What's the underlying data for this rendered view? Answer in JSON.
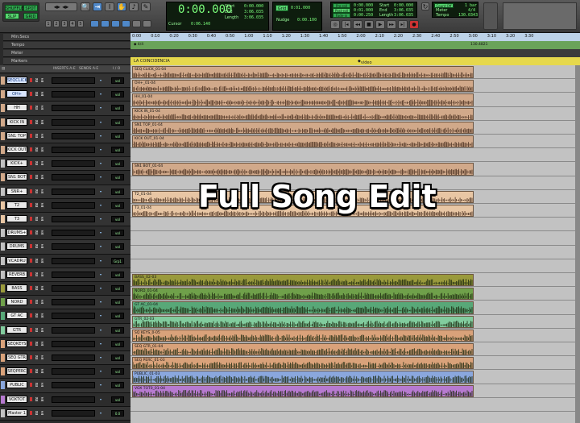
{
  "toolbar": {
    "mode_buttons": [
      "SHUFFLE",
      "SPOT",
      "SLIP",
      "GRID"
    ],
    "counter": "0:00.000",
    "cursor_label": "Cursor",
    "cursor_value": "0:06.140",
    "start_label": "Start",
    "end_label": "End",
    "length_label": "Length",
    "start_value": "0:00.000",
    "end_value": "3:06.035",
    "length_value": "3:06.035",
    "nudge_label": "Nudge",
    "nudge_value": "0:00.100",
    "grid_label": "Grid",
    "grid_value": "0:01.000",
    "preroll_label": "Pre-roll",
    "postroll_label": "Post-roll",
    "fadein_label": "Fade-in",
    "preroll_value": "0:00.000",
    "postroll_value": "0:01.000",
    "fadein_value": "0:00.250",
    "start2_value": "0:00.000",
    "end2_value": "3:06.035",
    "length2_value": "3:06.035",
    "countoff_label": "Count Off",
    "meter_label": "Meter",
    "tempo_label": "Tempo",
    "meter_value": "4/4",
    "tempo_value": "130.0343",
    "bars_value": "1 bar",
    "numbers": [
      "1",
      "2",
      "3",
      "4",
      "5"
    ]
  },
  "rulers": {
    "min_secs": "Min:Secs",
    "tempo": "Tempo",
    "meter": "Meter",
    "markers": "Markers",
    "ticks": [
      "0:00",
      "0:10",
      "0:20",
      "0:30",
      "0:40",
      "0:50",
      "1:00",
      "1:10",
      "1:20",
      "1:30",
      "1:40",
      "1:50",
      "2:00",
      "2:10",
      "2:20",
      "2:30",
      "2:40",
      "2:50",
      "3:00",
      "3:10",
      "3:20",
      "3:30"
    ],
    "tempo_value": "130.4821",
    "marker_1": "LA COINCIDENCIA",
    "marker_2": "video"
  },
  "column_headers": {
    "inserts": "INSERTS A-E",
    "sends": "SENDS A-E",
    "io": "I / O"
  },
  "tracks": [
    {
      "name": "SEQCLICK",
      "region": "SEQ CLICK_01-04",
      "color": "#d1a98a",
      "io": "vol",
      "small": false
    },
    {
      "name": "OH+",
      "region": "OH+_01-04",
      "color": "#d1a98a",
      "io": "vol",
      "small": true
    },
    {
      "name": "HH",
      "region": "HH_01-04",
      "color": "#d1a98a",
      "io": "vol",
      "small": true
    },
    {
      "name": "KICK IN",
      "region": "KICK IN_01-04",
      "color": "#d1a98a",
      "io": "vol",
      "small": false
    },
    {
      "name": "SN1 TOP",
      "region": "SN1 TOP_01-04",
      "color": "#d1a98a",
      "io": "vol",
      "small": true
    },
    {
      "name": "KICK OUT",
      "region": "KICK OUT_01-04",
      "color": "#d1a98a",
      "io": "vol",
      "small": true
    },
    {
      "name": "KICK+",
      "region": "",
      "color": "#c2c2c2",
      "io": "vol",
      "small": true
    },
    {
      "name": "SN1 BOT",
      "region": "SN1 BOT_01-04",
      "color": "#d1a98a",
      "io": "vol",
      "small": true
    },
    {
      "name": "SNR+",
      "region": "",
      "color": "#c2c2c2",
      "io": "vol",
      "small": true
    },
    {
      "name": "T2",
      "region": "T2_01-04",
      "color": "#e8c6a4",
      "io": "vol",
      "small": true
    },
    {
      "name": "T3",
      "region": "T3_01-04",
      "color": "#e8c6a4",
      "io": "vol",
      "small": true
    },
    {
      "name": "DRUMS+",
      "region": "",
      "color": "#c2c2c2",
      "io": "vol",
      "small": true
    },
    {
      "name": "DRUMS",
      "region": "",
      "color": "#c2c2c2",
      "io": "vol",
      "small": true
    },
    {
      "name": "VCADRU",
      "region": "",
      "color": "#c2c2c2",
      "io": "Grp1",
      "small": true
    },
    {
      "name": "REVERB",
      "region": "",
      "color": "#c2c2c2",
      "io": "vol",
      "small": true
    },
    {
      "name": "BASS",
      "region": "BASS_02-03",
      "color": "#9a9a3c",
      "io": "vol",
      "small": true
    },
    {
      "name": "NORD",
      "region": "NORD_01-04",
      "color": "#6fa04a",
      "io": "vol",
      "small": true
    },
    {
      "name": "GT AC",
      "region": "GT AC_01-04",
      "color": "#58a878",
      "io": "vol",
      "small": true
    },
    {
      "name": "GTR",
      "region": "GTR_02-03",
      "color": "#82cc9e",
      "io": "vol",
      "small": true
    },
    {
      "name": "SEQKEYS",
      "region": "SQ KEYS_0-05",
      "color": "#d9a27a",
      "io": "vol",
      "small": true
    },
    {
      "name": "SEQ GTR",
      "region": "SEQ GTR_01-04",
      "color": "#d9a27a",
      "io": "vol",
      "small": true
    },
    {
      "name": "SEQPERC",
      "region": "SEQ PERC_01-03",
      "color": "#d9a27a",
      "io": "vol",
      "small": true
    },
    {
      "name": "PUBLIC",
      "region": "PUBLIC_01-03",
      "color": "#8aa7dd",
      "io": "vol",
      "small": true
    },
    {
      "name": "VOXTOT",
      "region": "VOX TOT0_01-04",
      "color": "#b77ad0",
      "io": "vol",
      "small": true
    },
    {
      "name": "Master 1",
      "region": "",
      "color": "#c2c2c2",
      "io": "0.0",
      "small": true
    }
  ],
  "overlay_text": "Full Song Edit"
}
